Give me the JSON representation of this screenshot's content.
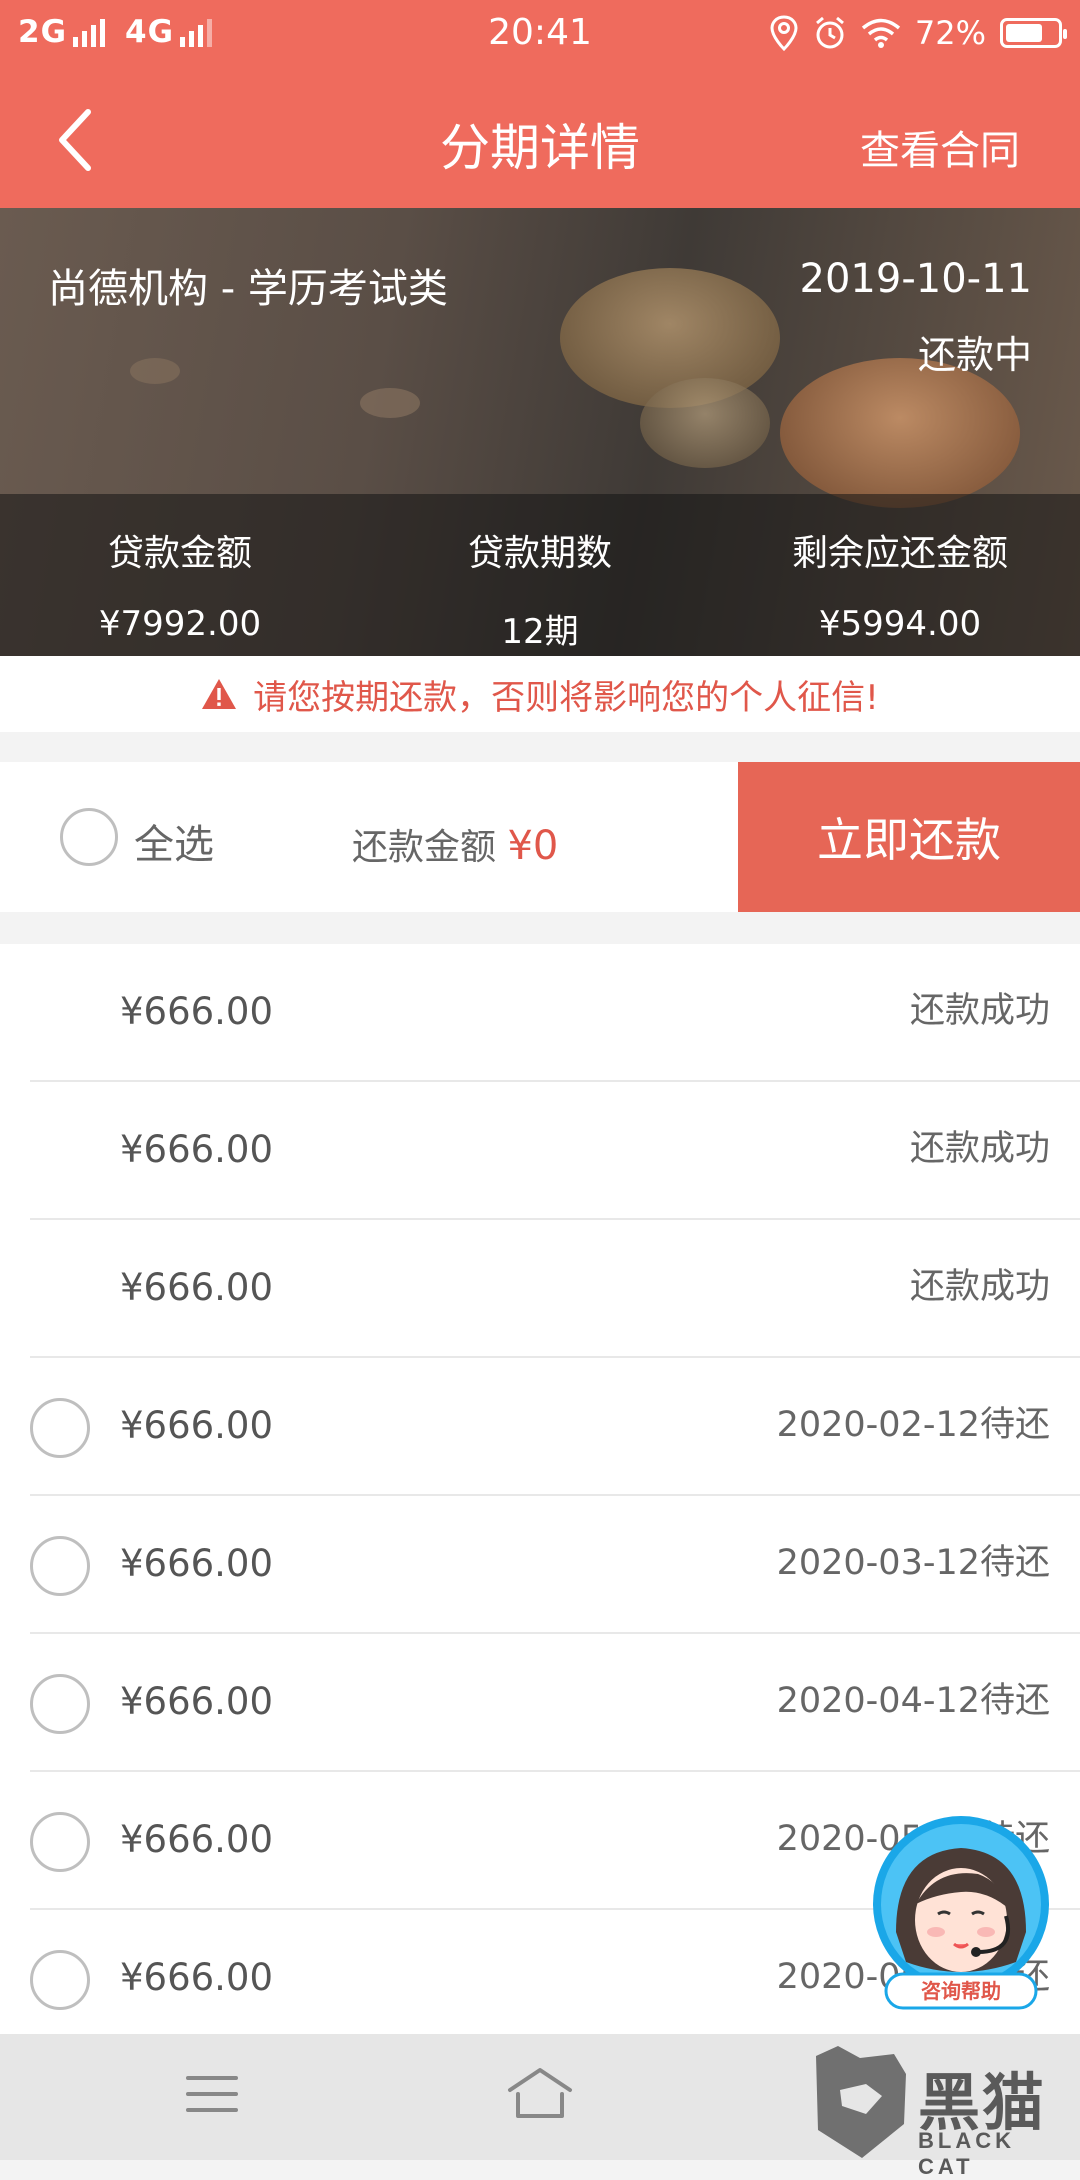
{
  "status_bar": {
    "network_1": "2G",
    "network_2": "4G",
    "time": "20:41",
    "battery": "72%",
    "battery_level": 0.72,
    "icons": [
      "location-icon",
      "alarm-icon",
      "wifi-icon",
      "battery-icon"
    ]
  },
  "nav": {
    "title": "分期详情",
    "action": "查看合同",
    "back_icon": "chevron-left-icon"
  },
  "hero": {
    "org": "尚德机构 - 学历考试类",
    "date": "2019-10-11",
    "status": "还款中",
    "stats": [
      {
        "label": "贷款金额",
        "value": "¥7992.00"
      },
      {
        "label": "贷款期数",
        "value": "12期"
      },
      {
        "label": "剩余应还金额",
        "value": "¥5994.00"
      }
    ]
  },
  "warning": {
    "text": "请您按期还款，否则将影响您的个人征信!",
    "icon": "warning-icon"
  },
  "actions": {
    "select_all": "全选",
    "amount_label": "还款金额",
    "amount_value": "¥0",
    "pay_button": "立即还款"
  },
  "installments": [
    {
      "amount": "¥666.00",
      "status": "还款成功",
      "selectable": false
    },
    {
      "amount": "¥666.00",
      "status": "还款成功",
      "selectable": false
    },
    {
      "amount": "¥666.00",
      "status": "还款成功",
      "selectable": false
    },
    {
      "amount": "¥666.00",
      "status": "2020-02-12待还",
      "selectable": true
    },
    {
      "amount": "¥666.00",
      "status": "2020-03-12待还",
      "selectable": true
    },
    {
      "amount": "¥666.00",
      "status": "2020-04-12待还",
      "selectable": true
    },
    {
      "amount": "¥666.00",
      "status": "2020-05-12待还",
      "selectable": true
    },
    {
      "amount": "¥666.00",
      "status": "2020-06-12待还",
      "selectable": true
    }
  ],
  "help": {
    "label": "咨询帮助"
  },
  "system_nav": {
    "icons": [
      "menu-icon",
      "home-icon",
      "back-icon"
    ]
  },
  "watermark": {
    "text": "黑猫",
    "sub": "BLACK CAT"
  },
  "colors": {
    "accent": "#ef6b5d",
    "warning": "#e0574a",
    "pay_button": "#e66656"
  }
}
